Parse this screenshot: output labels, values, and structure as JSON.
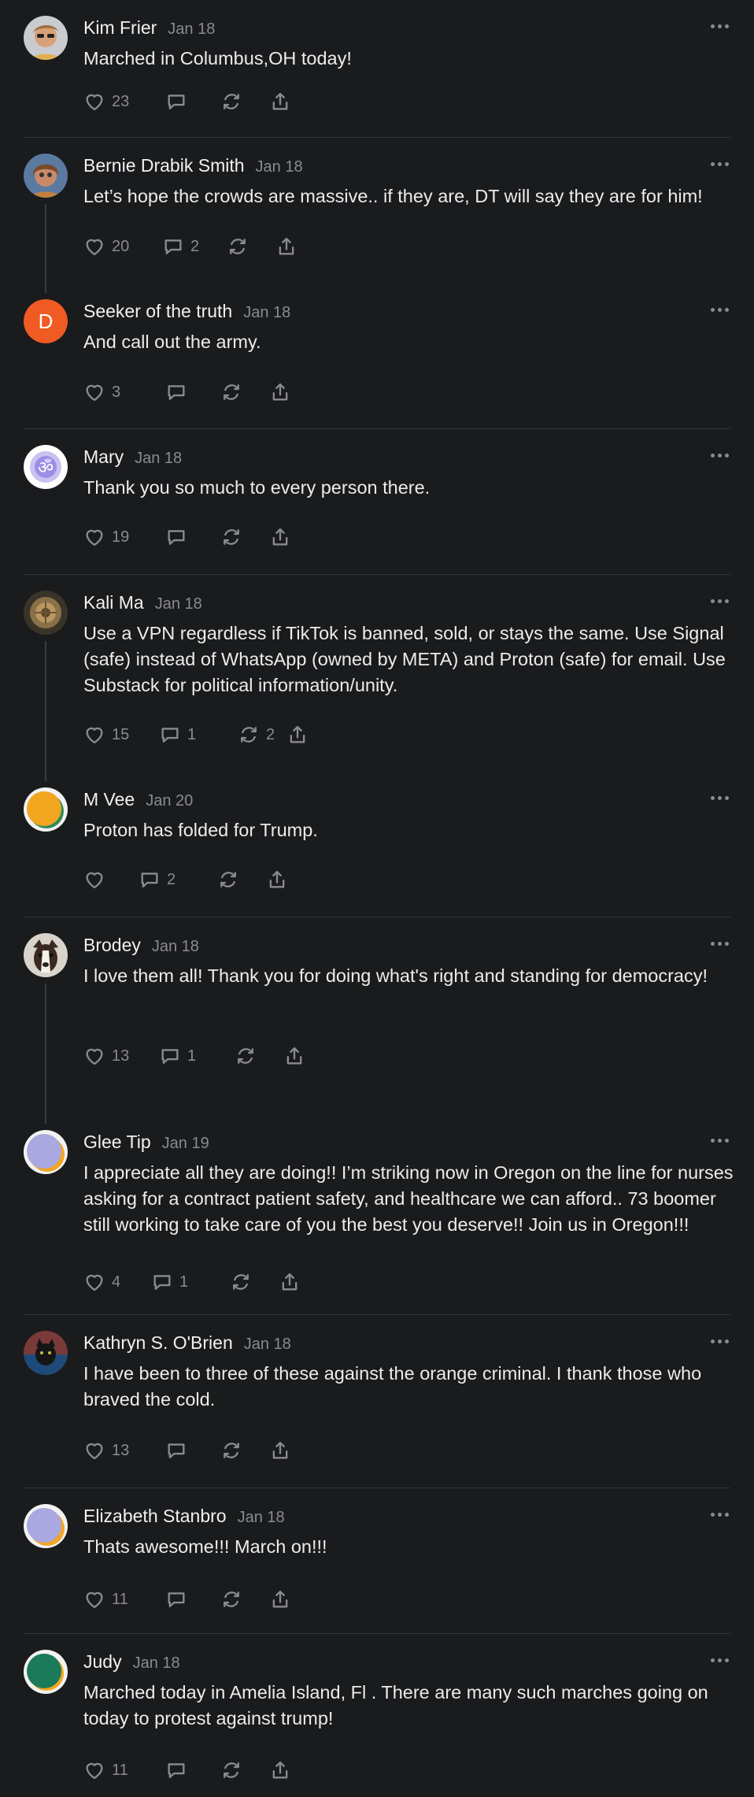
{
  "comments": [
    {
      "name": "Kim Frier",
      "date": "Jan 18",
      "text": "Marched in Columbus,OH today!",
      "likes": "23",
      "replies": "",
      "restacks": "",
      "avatar": "photo-woman-sunglasses"
    },
    {
      "name": "Bernie Drabik Smith",
      "date": "Jan 18",
      "text": "Let’s hope the crowds are massive.. if they are, DT will say they are for him!",
      "likes": "20",
      "replies": "2",
      "restacks": "",
      "avatar": "photo-woman"
    },
    {
      "name": "Seeker of the truth",
      "date": "Jan 18",
      "text": "And call out the army.",
      "likes": "3",
      "replies": "",
      "restacks": "",
      "avatar": "letter-avatar",
      "avatar_letter": "D",
      "avatar_color": "#f05a23"
    },
    {
      "name": "Mary",
      "date": "Jan 18",
      "text": "Thank you so much to every person there.",
      "likes": "19",
      "replies": "",
      "restacks": "",
      "avatar": "om-symbol",
      "avatar_letter": "ॐ"
    },
    {
      "name": "Kali Ma",
      "date": "Jan 18",
      "text": "Use a VPN regardless if TikTok is banned, sold, or stays the same. Use Signal (safe) instead of WhatsApp (owned by META) and Proton (safe) for email. Use Substack for political information/unity.",
      "likes": "15",
      "replies": "1",
      "restacks": "2",
      "avatar": "photo-bronze"
    },
    {
      "name": "M Vee",
      "date": "Jan 20",
      "text": "Proton has folded for Trump.",
      "likes": "",
      "replies": "2",
      "restacks": "",
      "avatar": "default-orange"
    },
    {
      "name": "Brodey",
      "date": "Jan 18",
      "text": "I love them all! Thank you for doing what's right and standing for democracy!",
      "likes": "13",
      "replies": "1",
      "restacks": "",
      "avatar": "photo-dog"
    },
    {
      "name": "Glee Tip",
      "date": "Jan 19",
      "text": "I appreciate all they are doing!! I’m striking now in Oregon on the line for nurses asking for a contract patient safety, and healthcare we can afford.. 73 boomer still working to take care of you the best you deserve!! Join us in Oregon!!!",
      "likes": "4",
      "replies": "1",
      "restacks": "",
      "avatar": "default-lavender"
    },
    {
      "name": "Kathryn S. O'Brien",
      "date": "Jan 18",
      "text": "I have been to three of these against the orange criminal. I thank those who braved the cold.",
      "likes": "13",
      "replies": "",
      "restacks": "",
      "avatar": "photo-cat"
    },
    {
      "name": "Elizabeth Stanbro",
      "date": "Jan 18",
      "text": "Thats awesome!!! March on!!!",
      "likes": "11",
      "replies": "",
      "restacks": "",
      "avatar": "default-lavender"
    },
    {
      "name": "Judy",
      "date": "Jan 18",
      "text": "Marched today in Amelia Island, Fl . There are many such marches going on today to protest against trump!",
      "likes": "11",
      "replies": "",
      "restacks": "",
      "avatar": "default-teal"
    }
  ],
  "icons": {
    "like": "heart-icon",
    "reply": "comment-icon",
    "restack": "restack-icon",
    "share": "share-icon",
    "more": "more-icon"
  },
  "colors": {
    "background": "#1a1b1d",
    "text": "#ececec",
    "muted": "#8a8b8e",
    "divider": "#323336",
    "letter_avatar": "#f05a23"
  }
}
